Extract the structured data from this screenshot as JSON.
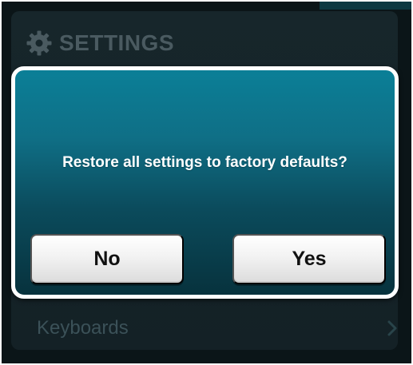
{
  "settings": {
    "title": "SETTINGS",
    "icon": "gear-icon",
    "rows": [
      {
        "label": "Keyboards",
        "icon": "chevron-right-icon"
      }
    ]
  },
  "dialog": {
    "message": "Restore all settings to factory defaults?",
    "buttons": {
      "no": "No",
      "yes": "Yes"
    }
  },
  "colors": {
    "background": "#0b1518",
    "panel": "#17262b",
    "dialog_top": "#0b7f97",
    "dialog_bottom": "#07323d",
    "dialog_border": "#ffffff",
    "button": "#f2f2f2",
    "button_text": "#111111",
    "muted_text": "#4a5a60"
  }
}
